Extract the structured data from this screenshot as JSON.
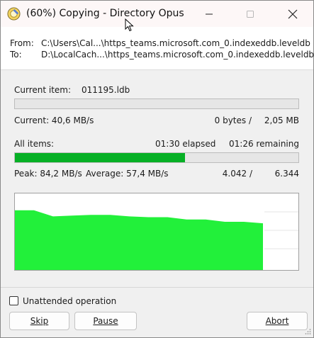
{
  "window": {
    "title": "(60%) Copying - Directory Opus",
    "controls": {
      "minimize": "minimize-icon",
      "maximize": "maximize-icon",
      "close": "close-icon"
    }
  },
  "paths": {
    "from_label": "From:",
    "from_value": "C:\\Users\\Cal...\\https_teams.microsoft.com_0.indexeddb.leveldb",
    "to_label": "To:",
    "to_value": "D:\\LocalCach...\\https_teams.microsoft.com_0.indexeddb.leveldb"
  },
  "current": {
    "item_label": "Current item:",
    "item_value": "011195.ldb",
    "progress": 0,
    "speed": "Current: 40,6 MB/s",
    "bytes_done": "0 bytes /",
    "bytes_total": "2,05 MB"
  },
  "all": {
    "label": "All items:",
    "elapsed": "01:30 elapsed",
    "remaining": "01:26 remaining",
    "progress": 0.6,
    "peak": "Peak: 84,2 MB/s",
    "average": "Average: 57,4 MB/s",
    "done": "4.042 /",
    "total": "6.344"
  },
  "graph": {
    "fill_color": "#22f03a",
    "grid_color": "#e4e4e4",
    "speed_profile": [
      0.78,
      0.78,
      0.7,
      0.71,
      0.72,
      0.72,
      0.7,
      0.69,
      0.69,
      0.66,
      0.66,
      0.63,
      0.63,
      0.61
    ]
  },
  "options": {
    "unattended": "Unattended operation",
    "unattended_checked": false
  },
  "buttons": {
    "skip": "Skip",
    "pause": "Pause",
    "abort": "Abort"
  },
  "colors": {
    "progress_green": "#06b025",
    "progress_track": "#e6e6e6"
  }
}
